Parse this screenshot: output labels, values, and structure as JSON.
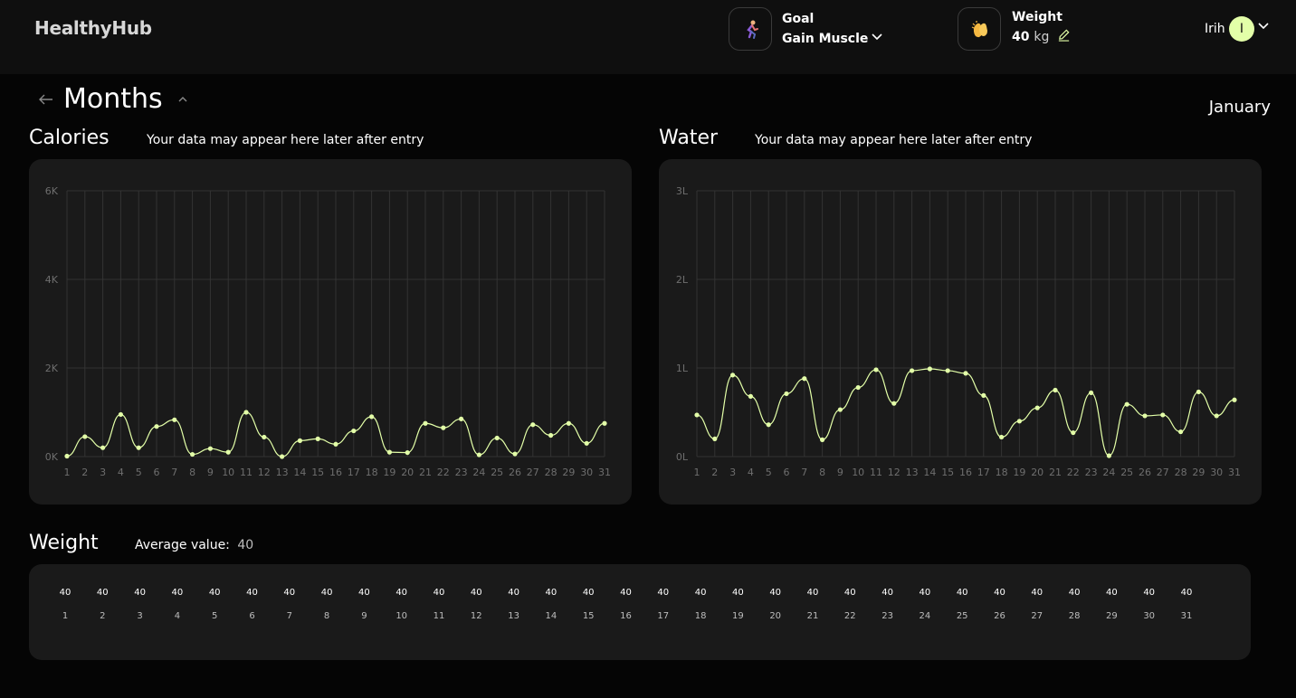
{
  "app": {
    "name": "HealthyHub"
  },
  "header": {
    "goal": {
      "title": "Goal",
      "value": "Gain Muscle",
      "icon": "runner-icon"
    },
    "weight": {
      "title": "Weight",
      "value": "40",
      "unit": "kg",
      "icon": "hands-icon"
    },
    "user": {
      "name": "Irih",
      "avatar_letter": "I"
    }
  },
  "page": {
    "title": "Months",
    "month": "January"
  },
  "calories": {
    "title": "Calories",
    "note": "Your data may appear here later after entry"
  },
  "water": {
    "title": "Water",
    "note": "Your data may appear here later after entry"
  },
  "weight_section": {
    "title": "Weight",
    "avg_label": "Average value:",
    "avg_value": "40"
  },
  "colors": {
    "accent": "#e3ffa8",
    "background": "#050505",
    "card": "#1a1a1a",
    "header": "#0f0f0f"
  },
  "chart_data": [
    {
      "type": "line",
      "x": [
        1,
        2,
        3,
        4,
        5,
        6,
        7,
        8,
        9,
        10,
        11,
        12,
        13,
        14,
        15,
        16,
        17,
        18,
        19,
        20,
        21,
        22,
        23,
        24,
        25,
        26,
        27,
        28,
        29,
        30,
        31
      ],
      "values": [
        10,
        450,
        200,
        950,
        200,
        680,
        830,
        50,
        180,
        100,
        1000,
        440,
        0,
        360,
        400,
        280,
        580,
        900,
        100,
        90,
        750,
        650,
        850,
        40,
        420,
        60,
        720,
        480,
        750,
        300,
        750
      ],
      "ylim": [
        0,
        6000
      ],
      "y_ticks": [
        "0K",
        "2K",
        "4K",
        "6K"
      ],
      "x_ticks": [
        "1",
        "2",
        "3",
        "4",
        "5",
        "6",
        "7",
        "8",
        "9",
        "10",
        "11",
        "12",
        "13",
        "14",
        "15",
        "16",
        "17",
        "18",
        "19",
        "20",
        "21",
        "22",
        "23",
        "24",
        "25",
        "26",
        "27",
        "28",
        "29",
        "30",
        "31"
      ],
      "grid": true
    },
    {
      "type": "line",
      "x": [
        1,
        2,
        3,
        4,
        5,
        6,
        7,
        8,
        9,
        10,
        11,
        12,
        13,
        14,
        15,
        16,
        17,
        18,
        19,
        20,
        21,
        22,
        23,
        24,
        25,
        26,
        27,
        28,
        29,
        30,
        31
      ],
      "values": [
        0.47,
        0.2,
        0.92,
        0.68,
        0.36,
        0.71,
        0.88,
        0.19,
        0.53,
        0.78,
        0.98,
        0.6,
        0.97,
        0.99,
        0.97,
        0.94,
        0.69,
        0.22,
        0.4,
        0.55,
        0.75,
        0.27,
        0.72,
        0.01,
        0.59,
        0.46,
        0.47,
        0.28,
        0.73,
        0.46,
        0.64
      ],
      "ylim": [
        0,
        3
      ],
      "y_ticks": [
        "0L",
        "1L",
        "2L",
        "3L"
      ],
      "x_ticks": [
        "1",
        "2",
        "3",
        "4",
        "5",
        "6",
        "7",
        "8",
        "9",
        "10",
        "11",
        "12",
        "13",
        "14",
        "15",
        "16",
        "17",
        "18",
        "19",
        "20",
        "21",
        "22",
        "23",
        "24",
        "25",
        "26",
        "27",
        "28",
        "29",
        "30",
        "31"
      ],
      "grid": true
    }
  ],
  "weight_days": [
    {
      "day": "1",
      "value": "40"
    },
    {
      "day": "2",
      "value": "40"
    },
    {
      "day": "3",
      "value": "40"
    },
    {
      "day": "4",
      "value": "40"
    },
    {
      "day": "5",
      "value": "40"
    },
    {
      "day": "6",
      "value": "40"
    },
    {
      "day": "7",
      "value": "40"
    },
    {
      "day": "8",
      "value": "40"
    },
    {
      "day": "9",
      "value": "40"
    },
    {
      "day": "10",
      "value": "40"
    },
    {
      "day": "11",
      "value": "40"
    },
    {
      "day": "12",
      "value": "40"
    },
    {
      "day": "13",
      "value": "40"
    },
    {
      "day": "14",
      "value": "40"
    },
    {
      "day": "15",
      "value": "40"
    },
    {
      "day": "16",
      "value": "40"
    },
    {
      "day": "17",
      "value": "40"
    },
    {
      "day": "18",
      "value": "40"
    },
    {
      "day": "19",
      "value": "40"
    },
    {
      "day": "20",
      "value": "40"
    },
    {
      "day": "21",
      "value": "40"
    },
    {
      "day": "22",
      "value": "40"
    },
    {
      "day": "23",
      "value": "40"
    },
    {
      "day": "24",
      "value": "40"
    },
    {
      "day": "25",
      "value": "40"
    },
    {
      "day": "26",
      "value": "40"
    },
    {
      "day": "27",
      "value": "40"
    },
    {
      "day": "28",
      "value": "40"
    },
    {
      "day": "29",
      "value": "40"
    },
    {
      "day": "30",
      "value": "40"
    },
    {
      "day": "31",
      "value": "40"
    }
  ]
}
